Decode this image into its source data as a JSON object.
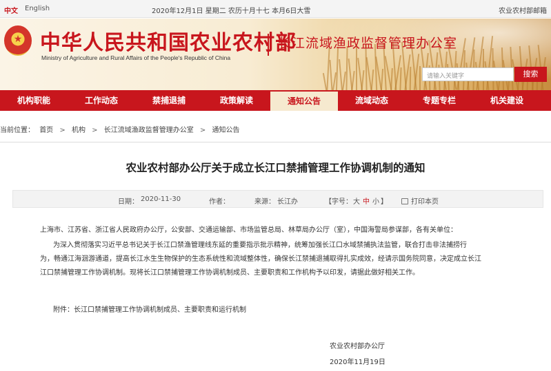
{
  "topbar": {
    "lang_cn": "中文",
    "lang_en": "English",
    "date": "2020年12月1日 星期二 农历十月十七 本月6日大雪",
    "mail": "农业农村部邮箱"
  },
  "header": {
    "title_cn": "中华人民共和国农业农村部",
    "title_en": "Ministry of Agriculture and Rural Affairs of the People's Republic of China",
    "office": "长江流域渔政监督管理办公室",
    "emblem_icon": "national-emblem-icon",
    "search_placeholder": "请输入关键字",
    "search_button": "搜索"
  },
  "nav": {
    "items": [
      {
        "label": "机构职能"
      },
      {
        "label": "工作动态"
      },
      {
        "label": "禁捕退捕"
      },
      {
        "label": "政策解读"
      },
      {
        "label": "通知公告"
      },
      {
        "label": "流域动态"
      },
      {
        "label": "专题专栏"
      },
      {
        "label": "机关建设"
      }
    ],
    "active": "通知公告",
    "accent": "#c8161d"
  },
  "breadcrumb": {
    "prefix": "当前位置：",
    "items": [
      "首页",
      "机构",
      "长江流域渔政监督管理办公室",
      "通知公告"
    ],
    "separator": ">"
  },
  "article": {
    "title": "农业农村部办公厅关于成立长江口禁捕管理工作协调机制的通知",
    "meta": {
      "date_label": "日期：",
      "date": "2020-11-30",
      "author_label": "作者：",
      "source_label": "来源：",
      "source": "长江办",
      "font_label_open": "【字号：",
      "font_large": "大",
      "font_medium": "中",
      "font_small": "小",
      "font_label_close": "】",
      "print": "打印本页",
      "print_icon": "printer-icon"
    },
    "addressee": "上海市、江苏省、浙江省人民政府办公厅，公安部、交通运输部、市场监管总局、林草局办公厅（室），中国海警局参谋部，各有关单位：",
    "body_lines": [
      "为深入贯彻落实习近平总书记关于长江口禁渔管理线东延的重要指示批示精神，统筹加强长江口水域禁捕执法监管，联合打击非法捕捞行",
      "为，畅通江海洄游通道，提高长江水生生物保护的生态系统性和流域整体性，确保长江禁捕退捕取得扎实成效，经请示国务院同意，决定成立长江",
      "江口禁捕管理工作协调机制。现将长江口禁捕管理工作协调机制成员、主要职责和工作机构予以印发，请据此做好相关工作。"
    ],
    "attachment": "附件：长江口禁捕管理工作协调机制成员、主要职责和运行机制",
    "signature": "农业农村部办公厅",
    "sign_date": "2020年11月19日"
  }
}
